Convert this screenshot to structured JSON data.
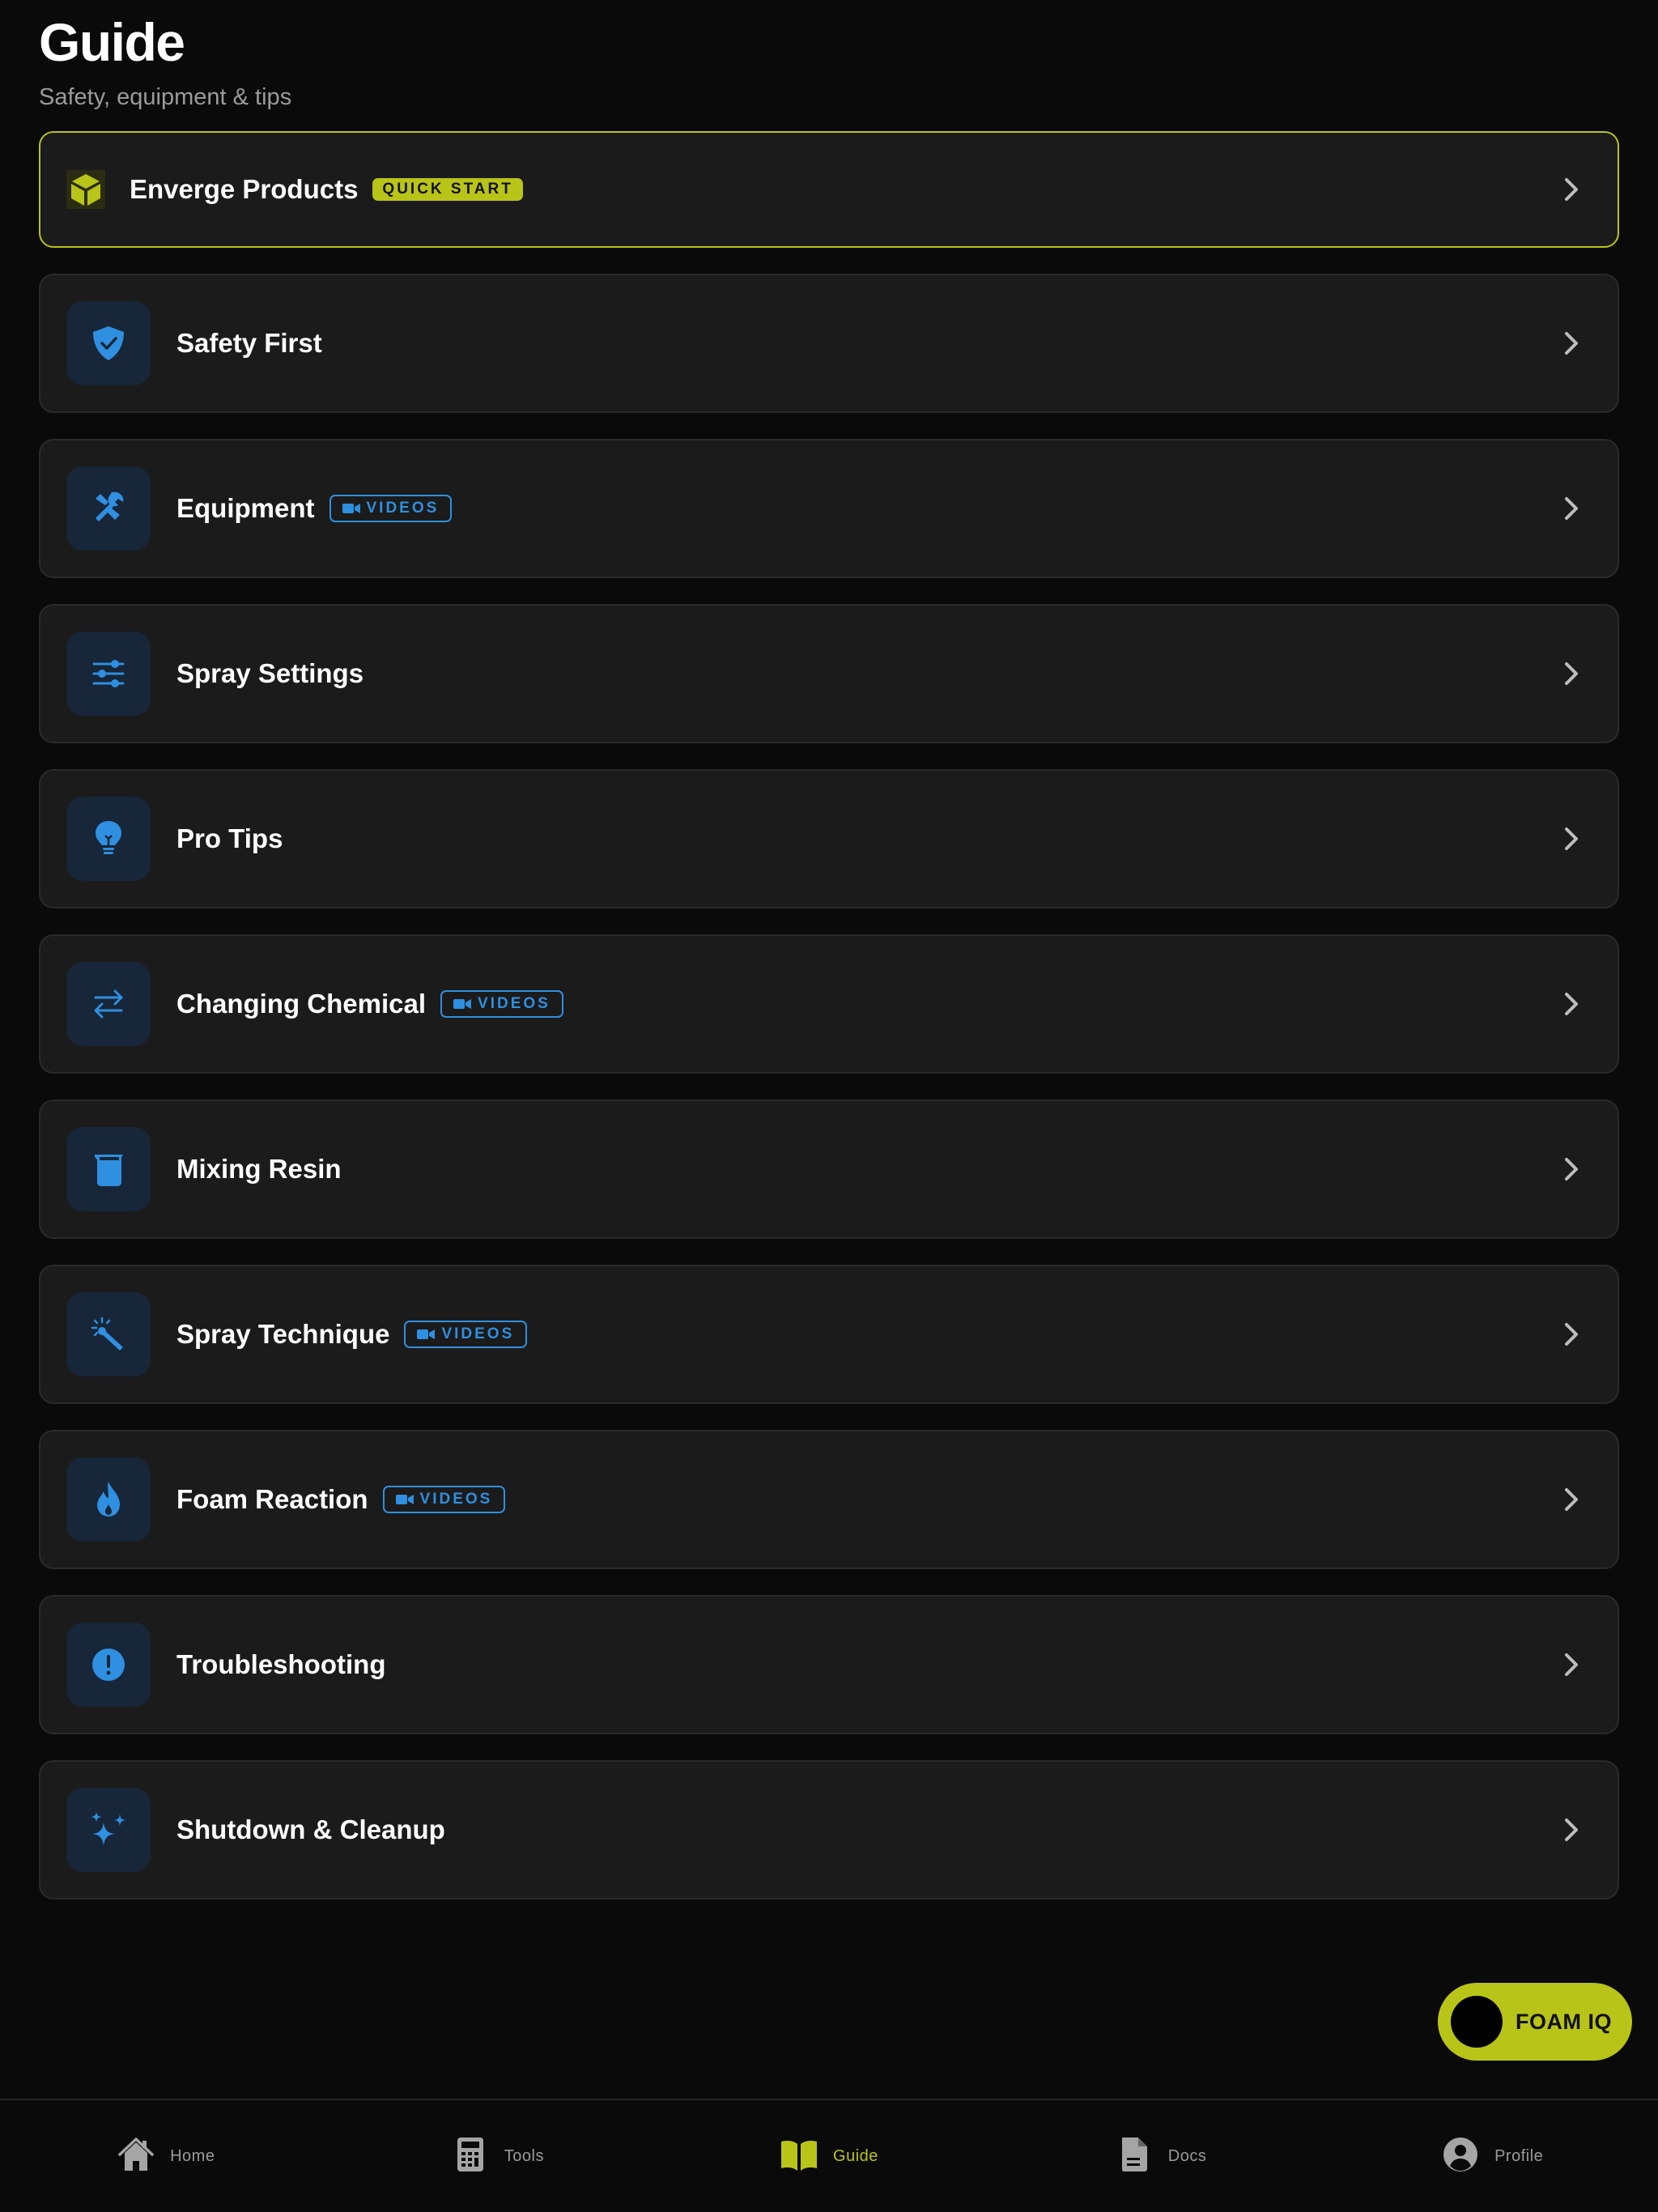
{
  "header": {
    "title": "Guide",
    "subtitle": "Safety, equipment & tips"
  },
  "featured": {
    "title": "Enverge Products",
    "badge": "QUICK START",
    "icon": "cube-icon"
  },
  "items": [
    {
      "title": "Safety First",
      "icon": "shield-check-icon",
      "badge": ""
    },
    {
      "title": "Equipment",
      "icon": "tools-icon",
      "badge": "VIDEOS"
    },
    {
      "title": "Spray Settings",
      "icon": "sliders-icon",
      "badge": ""
    },
    {
      "title": "Pro Tips",
      "icon": "lightbulb-icon",
      "badge": ""
    },
    {
      "title": "Changing Chemical",
      "icon": "swap-arrows-icon",
      "badge": "VIDEOS"
    },
    {
      "title": "Mixing Resin",
      "icon": "beaker-icon",
      "badge": ""
    },
    {
      "title": "Spray Technique",
      "icon": "magic-wand-icon",
      "badge": "VIDEOS"
    },
    {
      "title": "Foam Reaction",
      "icon": "flame-icon",
      "badge": "VIDEOS"
    },
    {
      "title": "Troubleshooting",
      "icon": "alert-circle-icon",
      "badge": ""
    },
    {
      "title": "Shutdown & Cleanup",
      "icon": "sparkles-icon",
      "badge": ""
    }
  ],
  "fab": {
    "label": "FOAM IQ"
  },
  "tabs": [
    {
      "label": "Home",
      "icon": "home-icon",
      "active": false
    },
    {
      "label": "Tools",
      "icon": "calculator-icon",
      "active": false
    },
    {
      "label": "Guide",
      "icon": "book-icon",
      "active": true
    },
    {
      "label": "Docs",
      "icon": "document-icon",
      "active": false
    },
    {
      "label": "Profile",
      "icon": "user-circle-icon",
      "active": false
    }
  ],
  "colors": {
    "accent": "#b9c418",
    "blue": "#2f8fe0",
    "background": "#0a0a0a",
    "card": "#1b1b1b"
  }
}
